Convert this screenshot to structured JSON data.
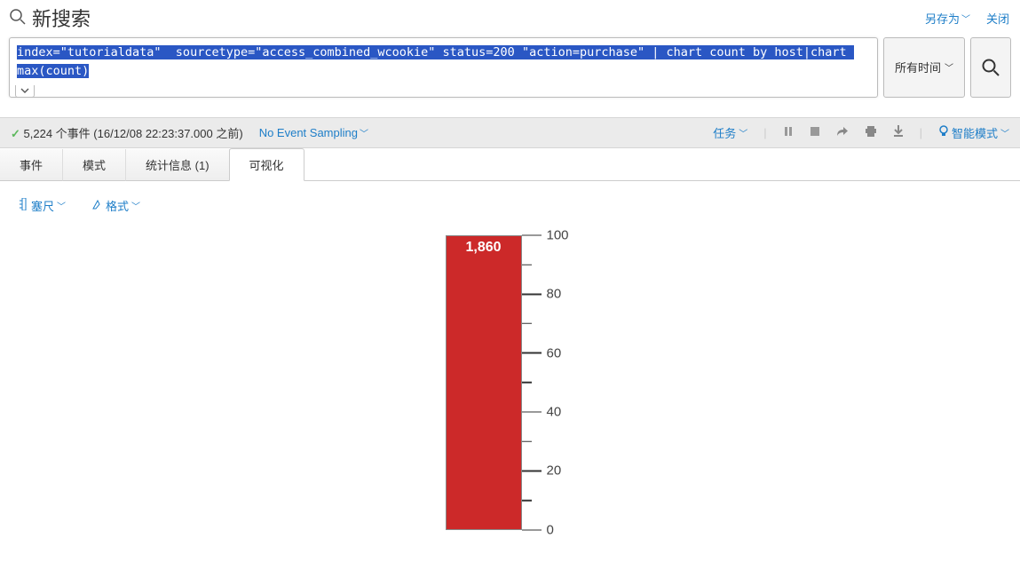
{
  "header": {
    "title": "新搜索",
    "save_as": "另存为",
    "close": "关闭"
  },
  "search": {
    "query": "index=\"tutorialdata\"  sourcetype=\"access_combined_wcookie\" status=200 \"action=purchase\" | chart count by host|chart max(count)",
    "time_label": "所有时间"
  },
  "jobbar": {
    "events_text": "5,224 个事件 (16/12/08 22:23:37.000 之前)",
    "sampling": "No Event Sampling",
    "task": "任务",
    "smart_mode": "智能模式"
  },
  "tabs": {
    "events": "事件",
    "patterns": "模式",
    "stats": "统计信息 (1)",
    "viz": "可视化"
  },
  "viz_toolbar": {
    "gauge": "塞尺",
    "format": "格式"
  },
  "chart_data": {
    "type": "bar",
    "categories": [
      "max(count)"
    ],
    "values": [
      1860
    ],
    "value_label": "1,860",
    "ylim": [
      0,
      100
    ],
    "major_ticks": [
      0,
      20,
      40,
      60,
      80,
      100
    ],
    "display_fill_fraction": 1.0
  }
}
